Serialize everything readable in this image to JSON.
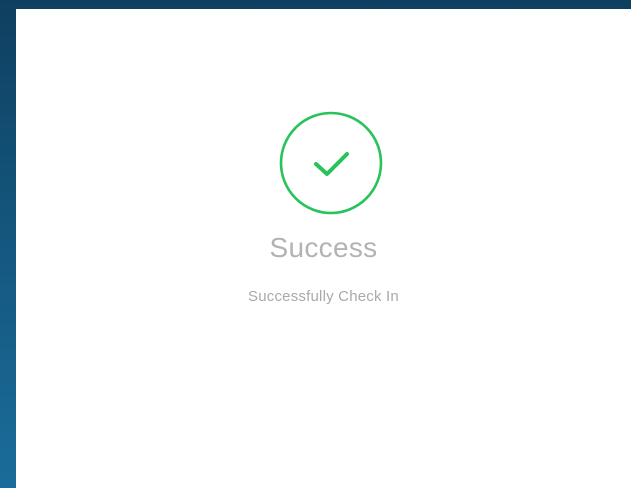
{
  "status": {
    "title": "Success",
    "message": "Successfully Check In",
    "icon": "check-circle-icon"
  },
  "colors": {
    "success": "#28c35b",
    "text_muted": "#b3b3b3",
    "background_outer": "#155a82",
    "card": "#ffffff"
  }
}
